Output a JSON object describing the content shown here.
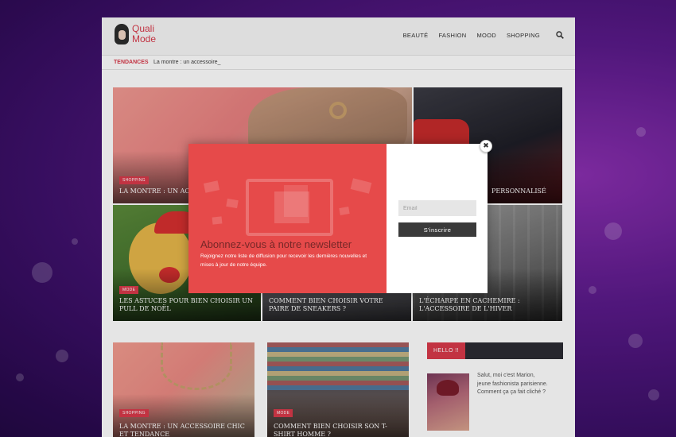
{
  "header": {
    "logo_line1": "Quali",
    "logo_line2": "Mode",
    "nav": [
      "BEAUTÉ",
      "FASHION",
      "MOOD",
      "SHOPPING"
    ]
  },
  "ticker": {
    "label": "TENDANCES",
    "text": "La montre : un accessoire_"
  },
  "cards": [
    {
      "badge": "SHOPPING",
      "title": "LA MONTRE : UN ACCE"
    },
    {
      "badge": "",
      "title": "PERSONNALISÉ"
    },
    {
      "badge": "MODE",
      "title": "LES ASTUCES POUR BIEN CHOISIR UN PULL DE NOËL"
    },
    {
      "badge": "",
      "title": "COMMENT BIEN CHOISIR VOTRE PAIRE DE SNEAKERS ?"
    },
    {
      "badge": "",
      "title": "L'ÉCHARPE EN CACHEMIRE : L'ACCESSOIRE DE L'HIVER"
    },
    {
      "badge": "SHOPPING",
      "title": "LA MONTRE : UN ACCESSOIRE CHIC ET TENDANCE"
    },
    {
      "badge": "MODE",
      "title": "COMMENT BIEN CHOISIR SON T-SHIRT HOMME ?"
    }
  ],
  "sidebar": {
    "heading": "HELLO !!",
    "bio_line1": "Salut, moi c'est Marion,",
    "bio_line2": "jeune fashionista parisienne.",
    "bio_line3": "Comment ça ça fait cliché ?"
  },
  "popup": {
    "title": "Abonnez-vous à notre newsletter",
    "subtitle": "Rejoignez notre liste de diffusion pour recevoir les dernières nouvelles et mises à jour de notre équipe.",
    "email_placeholder": "Email",
    "subscribe_label": "S'inscrire",
    "close_label": "✖"
  }
}
